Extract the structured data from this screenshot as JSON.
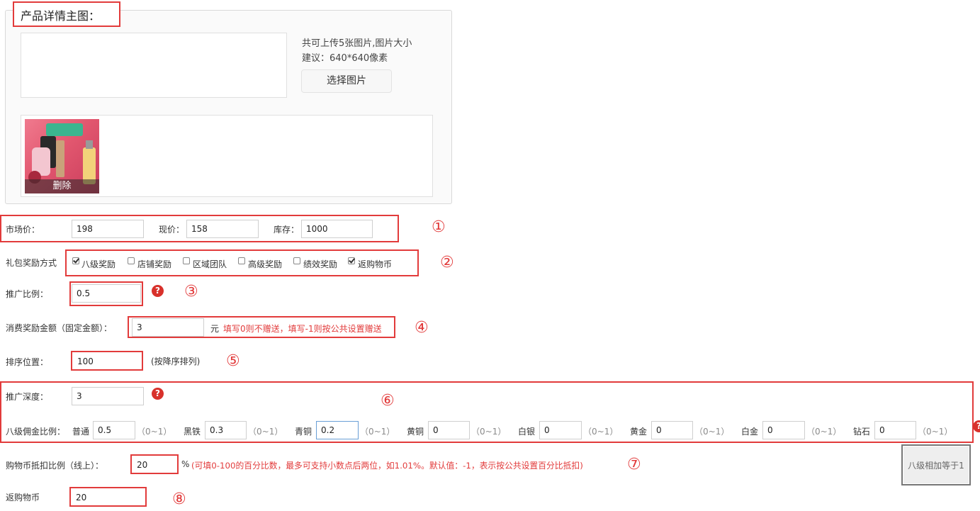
{
  "gallery": {
    "legend": "产品详情主图：",
    "upload_hint_line1": "共可上传5张图片,图片大小",
    "upload_hint_line2": "建议：640*640像素",
    "select_button": "选择图片",
    "thumb_delete": "删除"
  },
  "markers": [
    "①",
    "②",
    "③",
    "④",
    "⑤",
    "⑥",
    "⑦",
    "⑧"
  ],
  "prices": {
    "market_label": "市场价：",
    "market_value": "198",
    "current_label": "现价：",
    "current_value": "158",
    "stock_label": "库存：",
    "stock_value": "1000"
  },
  "reward": {
    "label": "礼包奖励方式",
    "options": [
      {
        "label": "八级奖励",
        "checked": true
      },
      {
        "label": "店铺奖励",
        "checked": false
      },
      {
        "label": "区域团队",
        "checked": false
      },
      {
        "label": "高级奖励",
        "checked": false
      },
      {
        "label": "绩效奖励",
        "checked": false
      },
      {
        "label": "返购物币",
        "checked": true
      }
    ]
  },
  "promo_ratio": {
    "label": "推广比例：",
    "value": "0.5",
    "help": "?"
  },
  "consume_reward": {
    "label": "消费奖励金额（固定金额）：",
    "value": "3",
    "unit": "元",
    "note": "填写0则不赠送，填写-1则按公共设置赠送"
  },
  "sort": {
    "label": "排序位置：",
    "value": "100",
    "note": "(按降序排列)"
  },
  "depth": {
    "label": "推广深度：",
    "value": "3",
    "help": "?"
  },
  "commission": {
    "label": "八级佣金比例：",
    "range": "（0~1）",
    "levels": [
      {
        "name": "普通",
        "value": "0.5"
      },
      {
        "name": "黑铁",
        "value": "0.3"
      },
      {
        "name": "青铜",
        "value": "0.2"
      },
      {
        "name": "黄铜",
        "value": "0"
      },
      {
        "name": "白银",
        "value": "0"
      },
      {
        "name": "黄金",
        "value": "0"
      },
      {
        "name": "白金",
        "value": "0"
      },
      {
        "name": "钻石",
        "value": "0"
      }
    ],
    "sum_button": "八级相加等于1"
  },
  "coin_deduct": {
    "label": "购物币抵扣比例（线上）：",
    "value": "20",
    "percent": "%",
    "note": "(可填0-100的百分比数，最多可支持小数点后两位，如1.01%。默认值：-1，表示按公共设置百分比抵扣)"
  },
  "rebate_coin": {
    "label": "返购物币",
    "value": "20"
  },
  "colors": {
    "accent_red": "#e23b3b",
    "help_red": "#d8312b",
    "focus_blue": "#6a9fd6"
  }
}
